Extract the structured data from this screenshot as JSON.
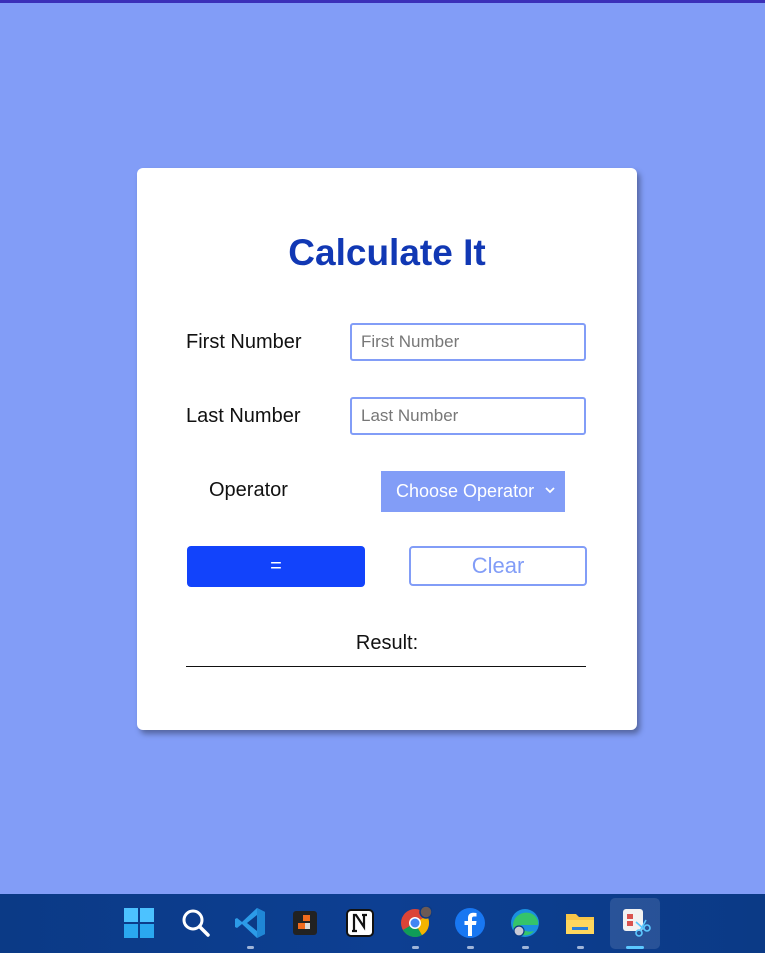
{
  "app": {
    "title": "Calculate It",
    "first_number": {
      "label": "First Number",
      "placeholder": "First Number",
      "value": ""
    },
    "last_number": {
      "label": "Last Number",
      "placeholder": "Last Number",
      "value": ""
    },
    "operator": {
      "label": "Operator",
      "selected": "Choose Operator"
    },
    "equals_label": "=",
    "clear_label": "Clear",
    "result_label": "Result:"
  },
  "colors": {
    "background": "#829df7",
    "title": "#1138b4",
    "primary_button": "#1243fb",
    "taskbar": "#0b3a86"
  },
  "taskbar": {
    "icons": [
      "windows-start-icon",
      "search-icon",
      "vscode-icon",
      "app-icon",
      "notion-icon",
      "chrome-icon",
      "facebook-icon",
      "edge-icon",
      "file-explorer-icon",
      "snipping-tool-icon"
    ]
  }
}
